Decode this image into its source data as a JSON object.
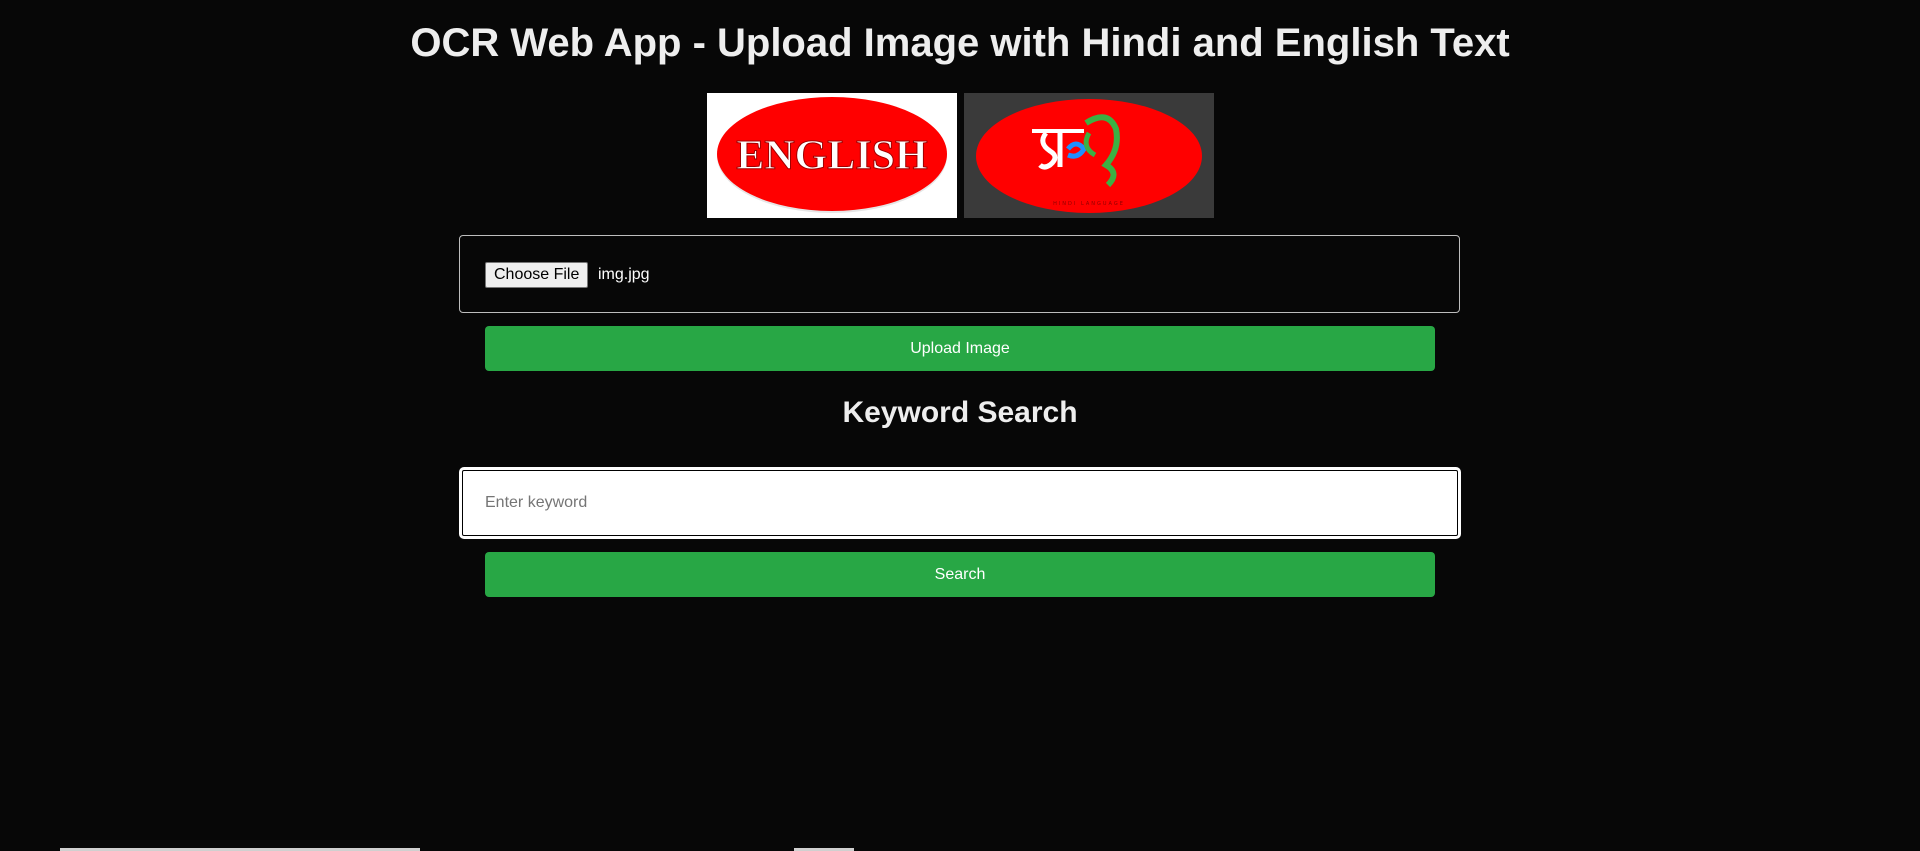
{
  "header": {
    "title": "OCR Web App - Upload Image with Hindi and English Text"
  },
  "badges": {
    "english": {
      "text": "ENGLISH",
      "color": "#ff0000"
    },
    "hindi": {
      "text": "हिन्दी",
      "color": "#ff0000"
    }
  },
  "upload": {
    "choose_file_label": "Choose File",
    "file_name": "img.jpg",
    "upload_button_label": "Upload Image"
  },
  "search": {
    "heading": "Keyword Search",
    "input_value": "",
    "input_placeholder": "Enter keyword",
    "search_button_label": "Search"
  },
  "colors": {
    "background": "#070707",
    "accent_green": "#28a745",
    "text_light": "#eeeeee"
  }
}
